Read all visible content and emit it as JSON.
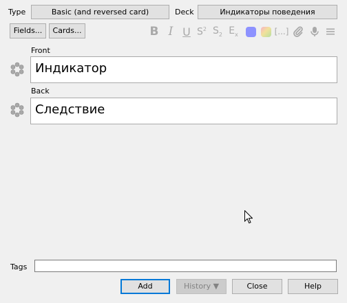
{
  "header": {
    "type_label": "Type",
    "note_type": "Basic (and reversed card)",
    "deck_label": "Deck",
    "deck": "Индикаторы поведения"
  },
  "toolbar": {
    "fields_button": "Fields...",
    "cards_button": "Cards...",
    "format_icons": [
      "bold-icon",
      "italic-icon",
      "underline-icon",
      "superscript-icon",
      "subscript-icon",
      "clear-format-icon",
      "text-color-icon",
      "highlight-color-icon",
      "cloze-icon",
      "attach-icon",
      "record-audio-icon",
      "more-menu-icon"
    ],
    "colors": {
      "text_color": "#8d92ff",
      "highlight_color": "#b7e0a0",
      "icon_gray": "#a9a9a9"
    }
  },
  "fields": [
    {
      "label": "Front",
      "value": "Индикатор"
    },
    {
      "label": "Back",
      "value": "Следствие"
    }
  ],
  "tags": {
    "label": "Tags",
    "value": ""
  },
  "footer": {
    "add": "Add",
    "history": "History ▼",
    "close": "Close",
    "help": "Help"
  }
}
